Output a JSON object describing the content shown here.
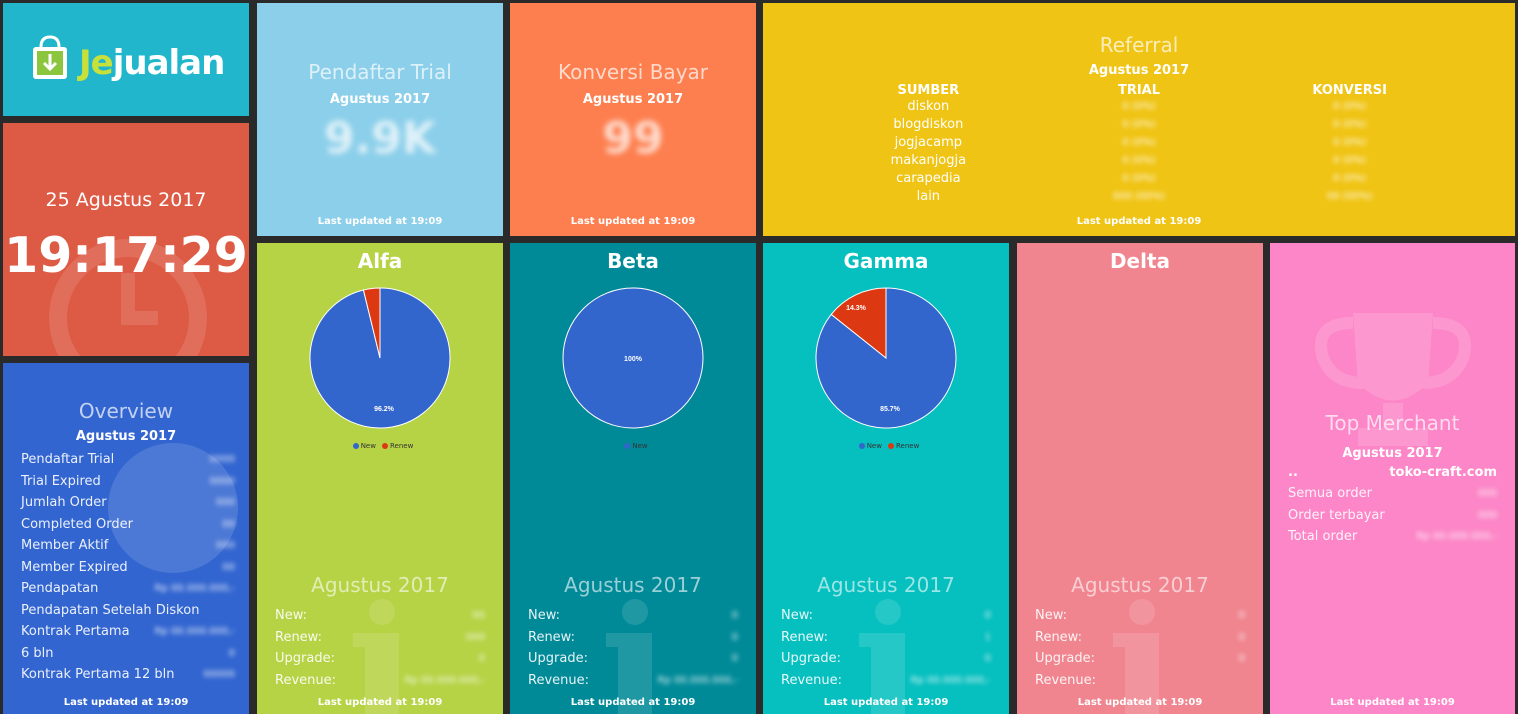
{
  "logo": {
    "text_je": "Je",
    "text_rest": "jualan"
  },
  "clock": {
    "date": "25 Agustus 2017",
    "time": "19:17:29"
  },
  "overview": {
    "title": "Overview",
    "period": "Agustus 2017",
    "rows": [
      {
        "label": "Pendaftar Trial",
        "value": "0000"
      },
      {
        "label": "Trial Expired",
        "value": "0000"
      },
      {
        "label": "Jumlah Order",
        "value": "000"
      },
      {
        "label": "Completed Order",
        "value": "00"
      },
      {
        "label": "Member Aktif",
        "value": "000"
      },
      {
        "label": "Member Expired",
        "value": "00"
      },
      {
        "label": "Pendapatan",
        "value": "Rp 00.000.000,-"
      },
      {
        "label": "Pendapatan Setelah Diskon",
        "value": ""
      },
      {
        "label": "Kontrak Pertama",
        "value": "Rp 00.000.000,-"
      },
      {
        "label": "6 bln",
        "value": "0"
      },
      {
        "label": "Kontrak Pertama 12 bln",
        "value": "00000"
      }
    ],
    "footer": "Last updated at 19:09"
  },
  "trial": {
    "title": "Pendaftar Trial",
    "period": "Agustus 2017",
    "value": "9.9K",
    "footer": "Last updated at 19:09"
  },
  "konversi": {
    "title": "Konversi Bayar",
    "period": "Agustus 2017",
    "value": "99",
    "footer": "Last updated at 19:09"
  },
  "referral": {
    "title": "Referral",
    "period": "Agustus 2017",
    "headers": [
      "SUMBER",
      "TRIAL",
      "KONVERSI"
    ],
    "rows": [
      {
        "sumber": "diskon",
        "trial": "0 (0%)",
        "konversi": "0 (0%)"
      },
      {
        "sumber": "blogdiskon",
        "trial": "0 (0%)",
        "konversi": "0 (0%)"
      },
      {
        "sumber": "jogjacamp",
        "trial": "0 (0%)",
        "konversi": "0 (0%)"
      },
      {
        "sumber": "makanjogja",
        "trial": "0 (0%)",
        "konversi": "0 (0%)"
      },
      {
        "sumber": "carapedia",
        "trial": "0 (0%)",
        "konversi": "0 (0%)"
      },
      {
        "sumber": "lain",
        "trial": "000 (00%)",
        "konversi": "00 (00%)"
      }
    ],
    "footer": "Last updated at 19:09"
  },
  "packages": [
    {
      "name": "Alfa",
      "pie_label_main": "96.2%",
      "pie_label_small": "",
      "legend": [
        "New",
        "Renew"
      ],
      "period": "Agustus 2017",
      "rows": [
        {
          "label": "New:",
          "value": "00"
        },
        {
          "label": "Renew:",
          "value": "000"
        },
        {
          "label": "Upgrade:",
          "value": "0"
        },
        {
          "label": "Revenue:",
          "value": "Rp 00.000.000,-"
        }
      ],
      "footer": "Last updated at 19:09"
    },
    {
      "name": "Beta",
      "pie_label_main": "100%",
      "pie_label_small": "",
      "legend": [
        "New"
      ],
      "period": "Agustus 2017",
      "rows": [
        {
          "label": "New:",
          "value": "0"
        },
        {
          "label": "Renew:",
          "value": "0"
        },
        {
          "label": "Upgrade:",
          "value": "0"
        },
        {
          "label": "Revenue:",
          "value": "Rp 00.000.000,-"
        }
      ],
      "footer": "Last updated at 19:09"
    },
    {
      "name": "Gamma",
      "pie_label_main": "85.7%",
      "pie_label_small": "14.3%",
      "legend": [
        "New",
        "Renew"
      ],
      "period": "Agustus 2017",
      "rows": [
        {
          "label": "New:",
          "value": "0"
        },
        {
          "label": "Renew:",
          "value": "1"
        },
        {
          "label": "Upgrade:",
          "value": "0"
        },
        {
          "label": "Revenue:",
          "value": "Rp 00.000.000,-"
        }
      ],
      "footer": "Last updated at 19:09"
    },
    {
      "name": "Delta",
      "pie_label_main": "",
      "pie_label_small": "",
      "legend": [],
      "period": "Agustus 2017",
      "rows": [
        {
          "label": "New:",
          "value": "0"
        },
        {
          "label": "Renew:",
          "value": "0"
        },
        {
          "label": "Upgrade:",
          "value": "0"
        },
        {
          "label": "Revenue:",
          "value": ""
        }
      ],
      "footer": "Last updated at 19:09"
    }
  ],
  "top_merchant": {
    "title": "Top Merchant",
    "period": "Agustus 2017",
    "dots": "..",
    "merchant": "toko-craft.com",
    "rows": [
      {
        "label": "Semua order",
        "value": "000"
      },
      {
        "label": "Order terbayar",
        "value": "000"
      },
      {
        "label": "Total order",
        "value": "Rp 00.000.000,-"
      }
    ],
    "footer": "Last updated at 19:09"
  },
  "chart_data": [
    {
      "type": "pie",
      "title": "Alfa",
      "categories": [
        "New",
        "Renew"
      ],
      "values": [
        96.2,
        3.8
      ]
    },
    {
      "type": "pie",
      "title": "Beta",
      "categories": [
        "New"
      ],
      "values": [
        100
      ]
    },
    {
      "type": "pie",
      "title": "Gamma",
      "categories": [
        "New",
        "Renew"
      ],
      "values": [
        85.7,
        14.3
      ]
    }
  ],
  "colors": {
    "logo_bg": "#21b6cb",
    "clock_bg": "#dd5a44",
    "overview_bg": "#3265d0",
    "trial_bg": "#8ccfea",
    "konversi_bg": "#fd7f4f",
    "referral_bg": "#f0c414",
    "alfa_bg": "#b6d345",
    "beta_bg": "#008a98",
    "gamma_bg": "#06bfbf",
    "delta_bg": "#f0858f",
    "merchant_bg": "#fc86c7",
    "pie_new": "#3366cc",
    "pie_renew": "#dc3912"
  }
}
